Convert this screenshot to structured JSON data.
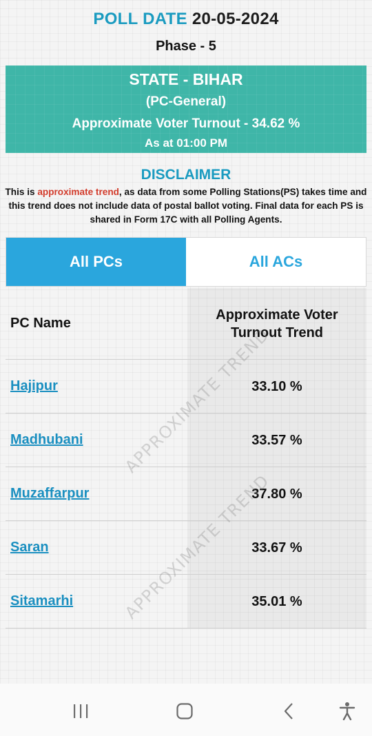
{
  "header": {
    "poll_label": "POLL DATE",
    "poll_date": "20-05-2024",
    "phase": "Phase - 5"
  },
  "state_box": {
    "title": "STATE - BIHAR",
    "subtitle": "(PC-General)",
    "turnout": "Approximate Voter Turnout - 34.62 %",
    "time": "As at 01:00 PM"
  },
  "disclaimer": {
    "title": "DISCLAIMER",
    "text_before": "This is ",
    "highlight": "approximate trend",
    "text_after": ", as data from some Polling Stations(PS) takes time and this trend does not include data of postal ballot voting. Final data for each PS is shared in Form 17C with all Polling Agents."
  },
  "tabs": {
    "all_pcs": "All PCs",
    "all_acs": "All ACs"
  },
  "table": {
    "col_name": "PC Name",
    "col_trend": "Approximate Voter Turnout Trend",
    "rows": [
      {
        "name": "Hajipur",
        "value": "33.10 %"
      },
      {
        "name": "Madhubani",
        "value": "33.57 %"
      },
      {
        "name": "Muzaffarpur",
        "value": "37.80 %"
      },
      {
        "name": "Saran",
        "value": "33.67 %"
      },
      {
        "name": "Sitamarhi",
        "value": "35.01 %"
      }
    ]
  },
  "watermark": "APPROXIMATE TREND",
  "colors": {
    "accent": "#1a9bc0",
    "state_box": "#3fb6a8",
    "tab_active": "#2aa6dd",
    "highlight_red": "#d23a2a"
  },
  "navbar": {
    "icons": [
      "recent-apps-icon",
      "home-icon",
      "back-icon",
      "accessibility-icon"
    ]
  }
}
